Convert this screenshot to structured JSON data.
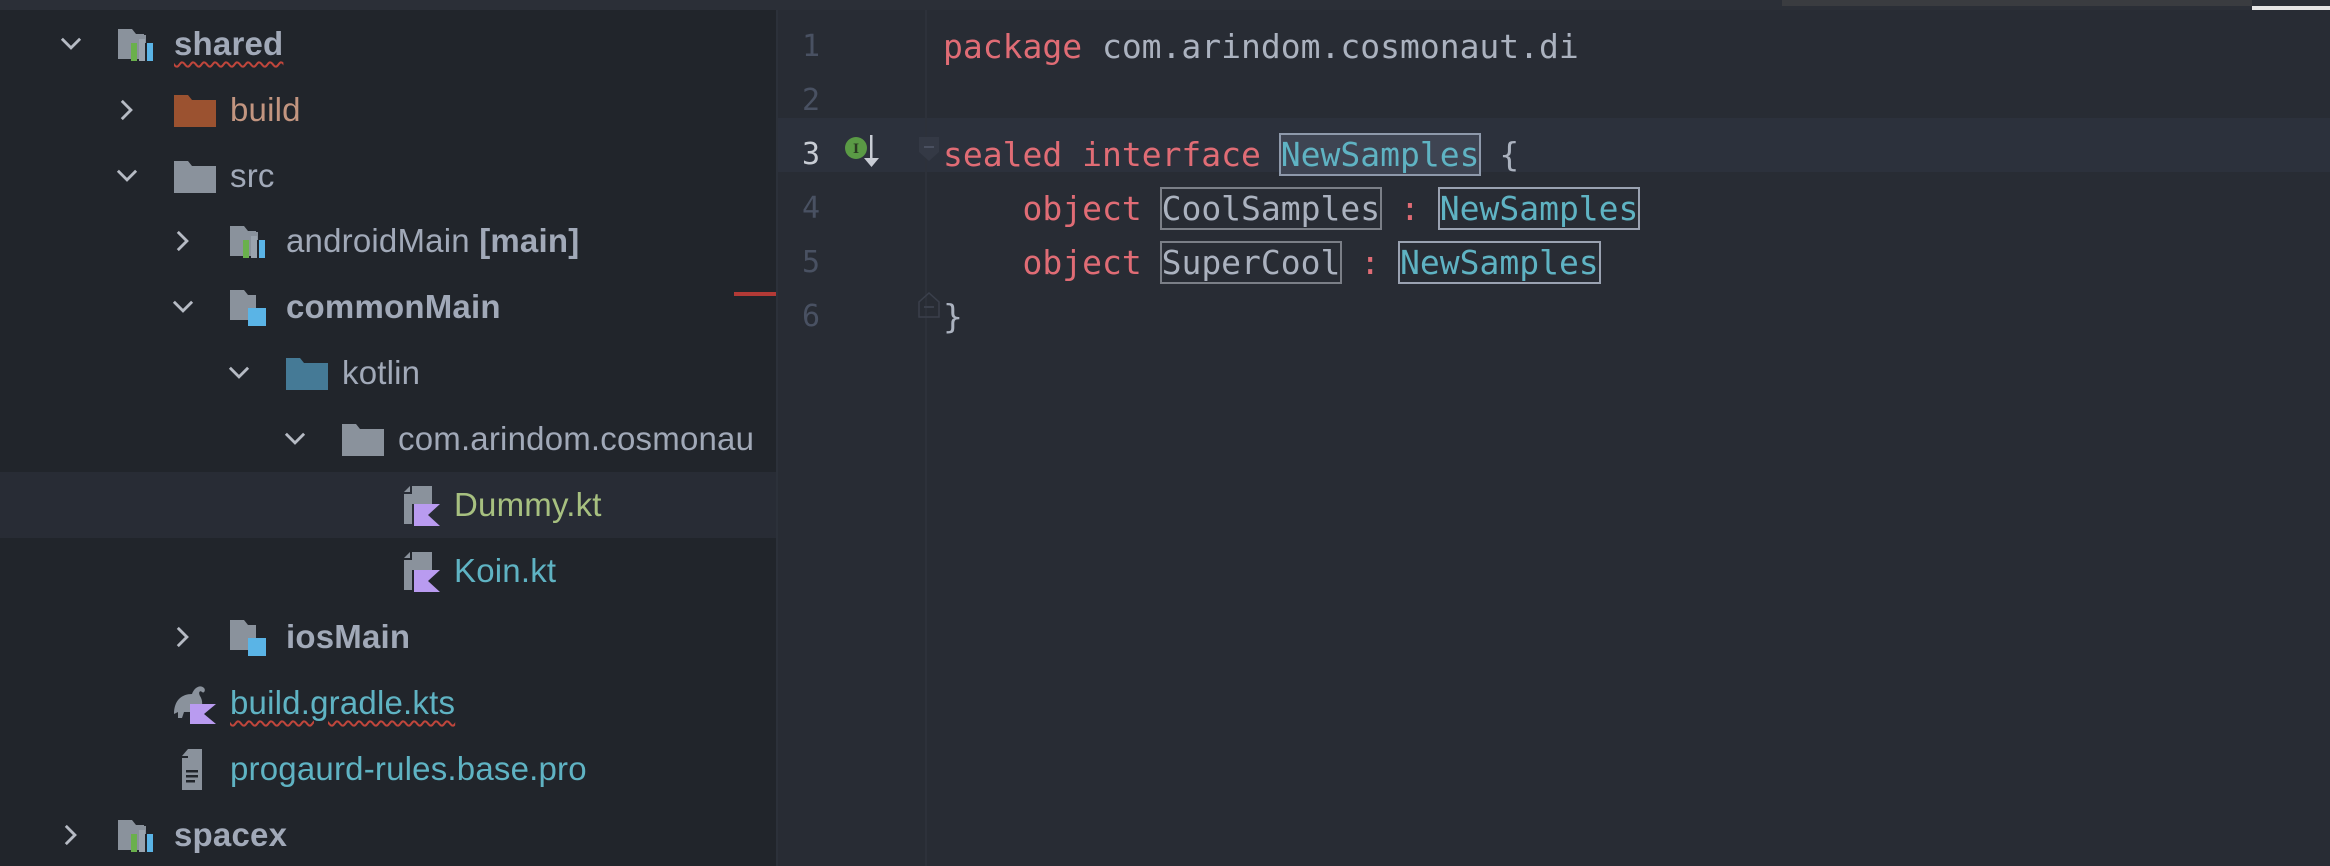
{
  "project_tree": {
    "items": [
      {
        "label": "shared",
        "expanded": true,
        "kind": "module",
        "error": true
      },
      {
        "label": "build",
        "expanded": false,
        "kind": "excluded-folder"
      },
      {
        "label": "src",
        "expanded": true,
        "kind": "folder"
      },
      {
        "label": "androidMain",
        "tag": "[main]",
        "expanded": false,
        "kind": "module"
      },
      {
        "label": "commonMain",
        "expanded": true,
        "kind": "source-set"
      },
      {
        "label": "kotlin",
        "expanded": true,
        "kind": "source-root"
      },
      {
        "label": "com.arindom.cosmonaut.di",
        "label_visible": "com.arindom.cosmonau",
        "expanded": true,
        "kind": "package"
      },
      {
        "label": "Dummy.kt",
        "kind": "kotlin-file",
        "selected": true,
        "status": "added"
      },
      {
        "label": "Koin.kt",
        "kind": "kotlin-file",
        "status": "modified"
      },
      {
        "label": "iosMain",
        "expanded": false,
        "kind": "source-set"
      },
      {
        "label": "build.gradle.kts",
        "kind": "gradle-kts-file",
        "error": true
      },
      {
        "label": "progaurd-rules.base.pro",
        "kind": "text-file"
      },
      {
        "label": "spacex",
        "expanded": false,
        "kind": "module"
      }
    ]
  },
  "editor": {
    "current_line": 3,
    "line_numbers": [
      "1",
      "2",
      "3",
      "4",
      "5",
      "6"
    ],
    "lines": {
      "l1": {
        "kw": "package",
        "rest": " com.arindom.cosmonaut.di"
      },
      "l3": {
        "kw1": "sealed",
        "kw2": "interface",
        "name": "NewSamples",
        "brace": " {"
      },
      "l4": {
        "indent": "    ",
        "kw": "object",
        "name": "CoolSamples",
        "colon": " : ",
        "type": "NewSamples"
      },
      "l5": {
        "indent": "    ",
        "kw": "object",
        "name": "SuperCool",
        "colon": " : ",
        "type": "NewSamples"
      },
      "l6": {
        "brace": "}"
      }
    },
    "gutter_icon": "implemented-by-icon"
  },
  "colors": {
    "keyword": "#e06c75",
    "type": "#5fb3c3",
    "text": "#abb2bf",
    "added_file": "#a7c080",
    "modified_file": "#5fb3c3",
    "excluded": "#c29580",
    "error_underline": "#c0463c"
  }
}
